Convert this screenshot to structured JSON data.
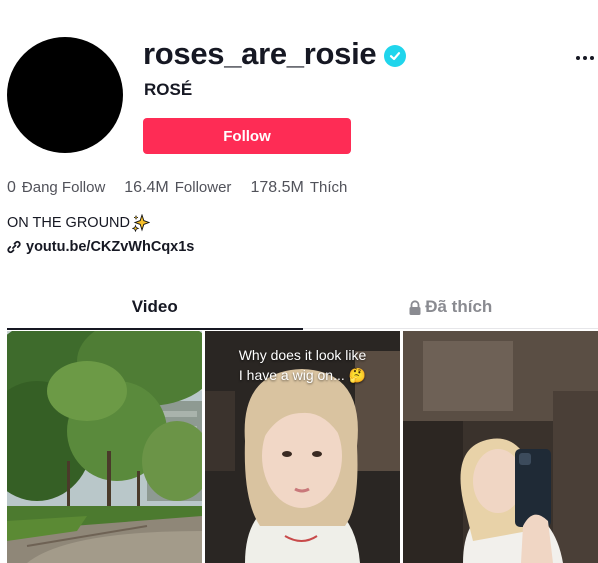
{
  "profile": {
    "username": "roses_are_rosie",
    "display_name": "ROSÉ",
    "follow_label": "Follow",
    "bio": "ON THE GROUND",
    "link": "youtu.be/CKZvWhCqx1s",
    "verified_color": "#20d5ec",
    "accent_color": "#fe2c55"
  },
  "stats": [
    {
      "value": "0",
      "label": "Đang Follow"
    },
    {
      "value": "16.4M",
      "label": "Follower"
    },
    {
      "value": "178.5M",
      "label": "Thích"
    }
  ],
  "tabs": [
    {
      "label": "Video",
      "active": true
    },
    {
      "label": "Đã thích",
      "active": false,
      "icon": "lock-icon"
    }
  ],
  "videos": [
    {
      "caption": "",
      "scene": "trees-park"
    },
    {
      "caption": "Why does it look like I have a wig on...",
      "emoji": "🤔",
      "scene": "selfie-face"
    },
    {
      "caption": "",
      "scene": "mirror-selfie"
    }
  ]
}
